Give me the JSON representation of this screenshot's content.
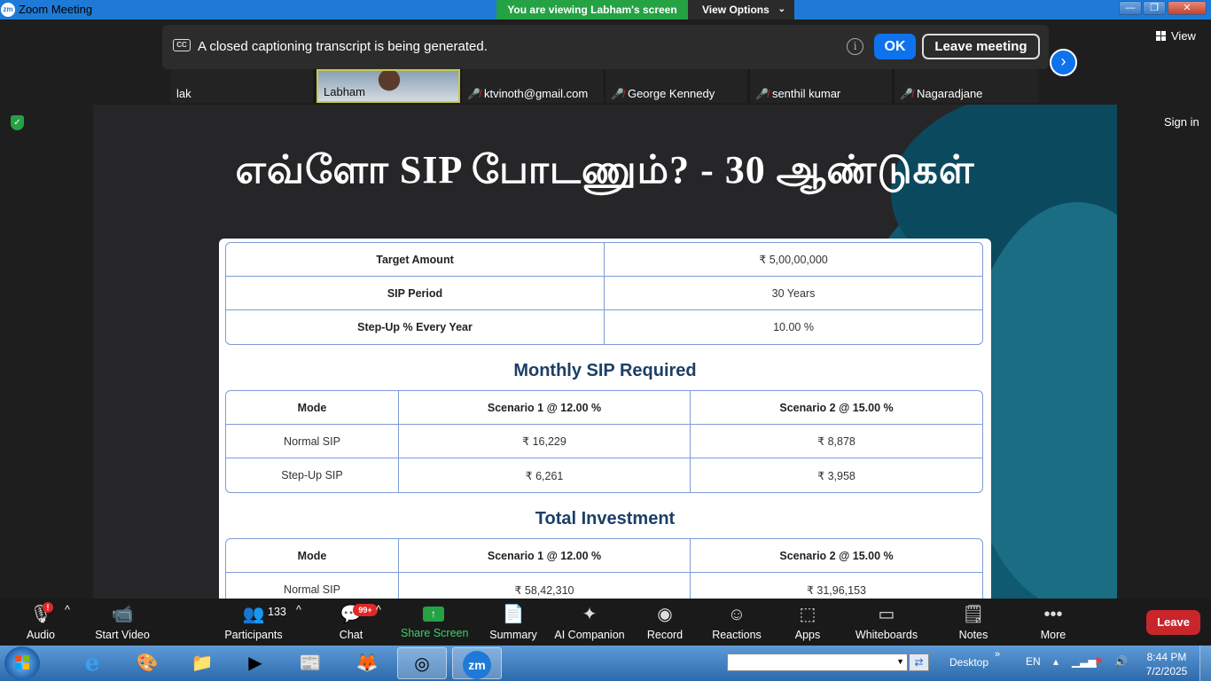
{
  "window": {
    "title": "Zoom Meeting",
    "app_icon": "zm",
    "minimize": "—",
    "maximize": "❐",
    "close": "✕"
  },
  "banner": {
    "viewing": "You are viewing Labham's screen",
    "view_options": "View Options"
  },
  "caption": {
    "cc": "CC",
    "text": "A closed captioning transcript is being generated.",
    "ok": "OK",
    "leave_meeting": "Leave meeting"
  },
  "top_right": {
    "view": "View",
    "sign_in": "Sign in"
  },
  "participants_strip": [
    {
      "name": "lak",
      "muted": false
    },
    {
      "name": "Labham",
      "muted": false
    },
    {
      "name": "ktvinoth@gmail.com",
      "muted": true
    },
    {
      "name": "George Kennedy",
      "muted": true
    },
    {
      "name": "senthil kumar",
      "muted": true
    },
    {
      "name": "Nagaradjane",
      "muted": true
    }
  ],
  "slide": {
    "title": "எவ்ளோ SIP போடணும்? - 30 ஆண்டுகள்",
    "summary": [
      {
        "label": "Target Amount",
        "value": "₹ 5,00,00,000"
      },
      {
        "label": "SIP Period",
        "value": "30 Years"
      },
      {
        "label": "Step-Up % Every Year",
        "value": "10.00 %"
      }
    ],
    "monthly_title": "Monthly SIP Required",
    "headers": [
      "Mode",
      "Scenario 1 @ 12.00 %",
      "Scenario 2 @ 15.00 %"
    ],
    "monthly_rows": [
      [
        "Normal SIP",
        "₹ 16,229",
        "₹ 8,878"
      ],
      [
        "Step-Up SIP",
        "₹ 6,261",
        "₹ 3,958"
      ]
    ],
    "investment_title": "Total Investment",
    "investment_rows": [
      [
        "Normal SIP",
        "₹ 58,42,310",
        "₹ 31,96,153"
      ]
    ]
  },
  "controls": {
    "audio": "Audio",
    "start_video": "Start Video",
    "participants": "Participants",
    "participants_count": "133",
    "chat": "Chat",
    "chat_badge": "99+",
    "share_screen": "Share Screen",
    "summary": "Summary",
    "ai_companion": "AI Companion",
    "record": "Record",
    "reactions": "Reactions",
    "apps": "Apps",
    "whiteboards": "Whiteboards",
    "notes": "Notes",
    "more": "More",
    "leave": "Leave",
    "audio_badge": "!"
  },
  "taskbar": {
    "desktop": "Desktop",
    "lang": "EN",
    "time": "8:44 PM",
    "date": "7/2/2025",
    "zoom_label": "zm"
  },
  "colors": {
    "zoom_blue": "#0e72ed",
    "green": "#25a244",
    "leave_red": "#c8262b",
    "table_border": "#7d9cd9",
    "section_title": "#1c3f66"
  }
}
